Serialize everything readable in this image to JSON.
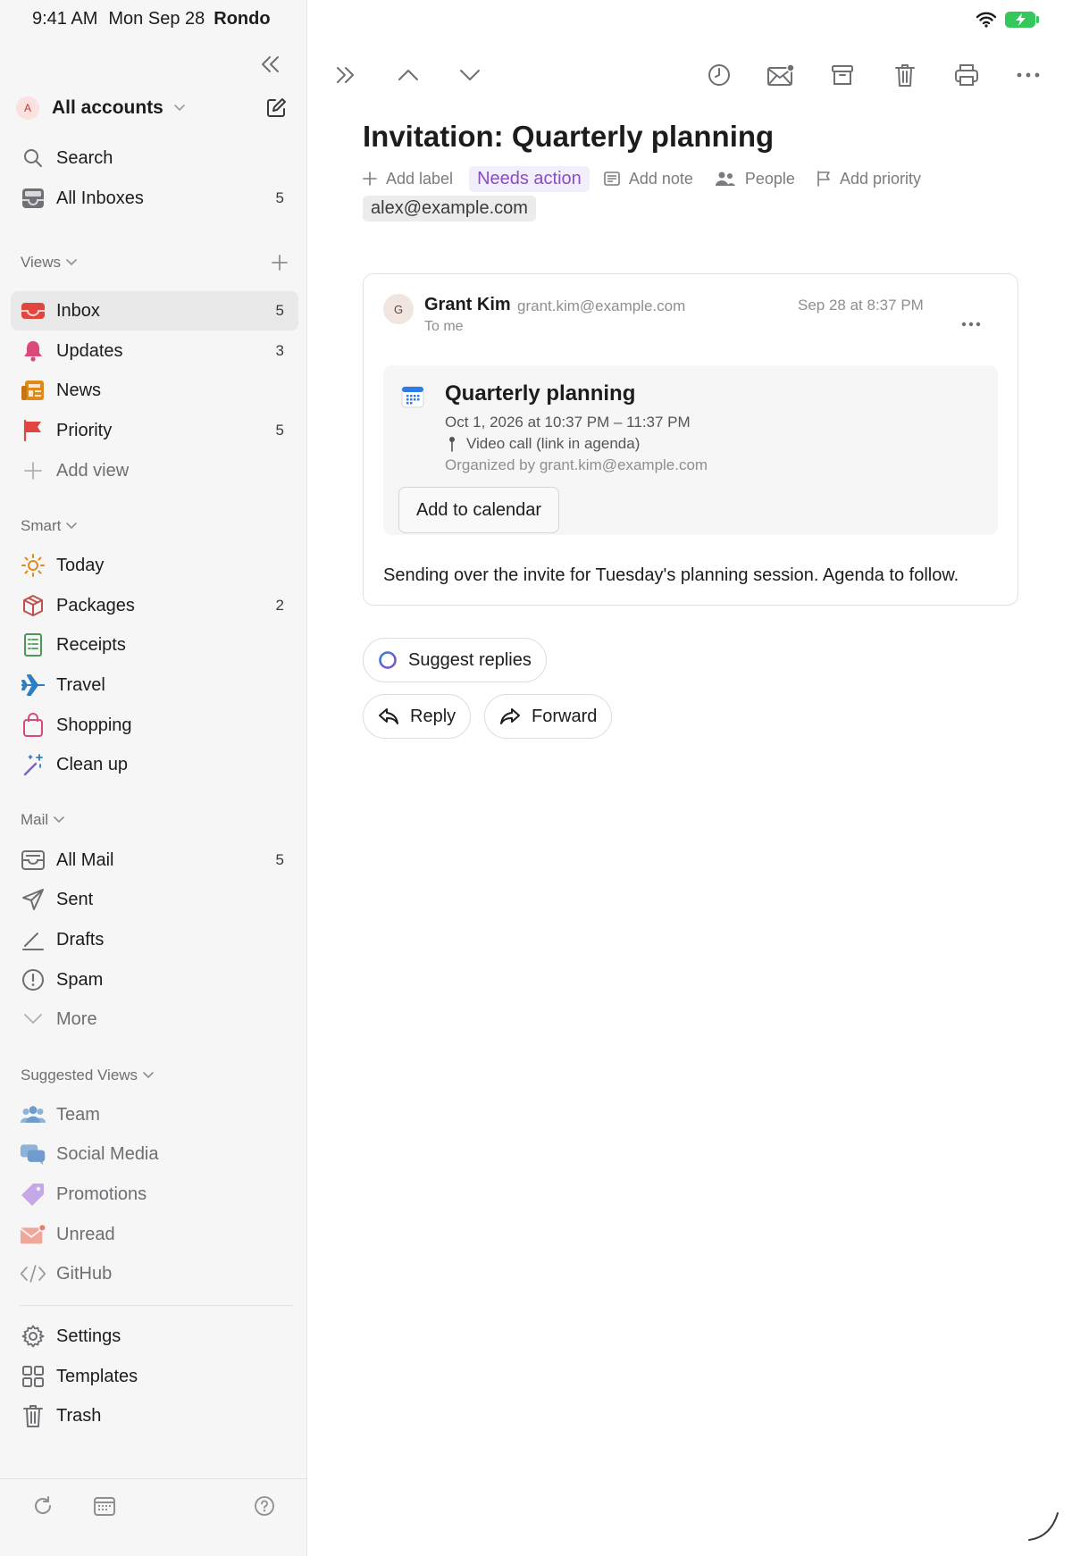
{
  "status_bar": {
    "time": "9:41 AM",
    "date": "Mon Sep 28",
    "app": "Rondo"
  },
  "account": {
    "avatar_letter": "A",
    "label": "All accounts"
  },
  "top_nav": [
    {
      "label": "Search",
      "icon": "search-icon"
    },
    {
      "label": "All Inboxes",
      "icon": "inboxes-icon",
      "count": "5"
    }
  ],
  "views": {
    "header": "Views",
    "items": [
      {
        "label": "Inbox",
        "icon": "inbox-icon",
        "count": "5",
        "active": true
      },
      {
        "label": "Updates",
        "icon": "bell-icon",
        "count": "3"
      },
      {
        "label": "News",
        "icon": "newspaper-icon",
        "count": ""
      },
      {
        "label": "Priority",
        "icon": "flag-icon",
        "count": "5"
      },
      {
        "label": "Add view",
        "icon": "plus-icon",
        "count": ""
      }
    ]
  },
  "smart": {
    "header": "Smart",
    "items": [
      {
        "label": "Today",
        "icon": "sun-icon",
        "count": ""
      },
      {
        "label": "Packages",
        "icon": "package-icon",
        "count": "2"
      },
      {
        "label": "Receipts",
        "icon": "receipt-icon",
        "count": ""
      },
      {
        "label": "Travel",
        "icon": "airplane-icon",
        "count": ""
      },
      {
        "label": "Shopping",
        "icon": "shopping-bag-icon",
        "count": ""
      },
      {
        "label": "Clean up",
        "icon": "magic-wand-icon",
        "count": ""
      }
    ]
  },
  "mail": {
    "header": "Mail",
    "items": [
      {
        "label": "All Mail",
        "icon": "tray-icon",
        "count": "5"
      },
      {
        "label": "Sent",
        "icon": "paper-plane-icon",
        "count": ""
      },
      {
        "label": "Drafts",
        "icon": "pencil-icon",
        "count": ""
      },
      {
        "label": "Spam",
        "icon": "warning-circle-icon",
        "count": ""
      },
      {
        "label": "More",
        "icon": "chevron-down-icon",
        "count": ""
      }
    ]
  },
  "suggested": {
    "header": "Suggested Views",
    "items": [
      {
        "label": "Team",
        "icon": "people-icon"
      },
      {
        "label": "Social Media",
        "icon": "chat-bubbles-icon"
      },
      {
        "label": "Promotions",
        "icon": "tag-icon"
      },
      {
        "label": "Unread",
        "icon": "unread-envelope-icon"
      },
      {
        "label": "GitHub",
        "icon": "code-icon"
      }
    ]
  },
  "bottom_nav": [
    {
      "label": "Settings",
      "icon": "gear-icon"
    },
    {
      "label": "Templates",
      "icon": "grid-icon"
    },
    {
      "label": "Trash",
      "icon": "trash-icon"
    }
  ],
  "email": {
    "subject": "Invitation: Quarterly planning",
    "meta": {
      "add_label": "Add label",
      "status_badge": "Needs action",
      "add_note": "Add note",
      "people": "People",
      "add_priority": "Add priority",
      "recipient_chip": "alex@example.com"
    },
    "message": {
      "avatar_letter": "G",
      "sender_name": "Grant Kim",
      "sender_email": "grant.kim@example.com",
      "to": "To me",
      "date": "Sep 28 at 8:37 PM",
      "invite": {
        "title": "Quarterly planning",
        "when": "Oct 1, 2026 at 10:37 PM – 11:37 PM",
        "location": "Video call (link in agenda)",
        "organizer": "Organized by grant.kim@example.com",
        "add_button": "Add to calendar"
      },
      "body": "Sending over the invite for Tuesday's planning session. Agenda to follow."
    },
    "actions": {
      "suggest_replies": "Suggest replies",
      "reply": "Reply",
      "forward": "Forward"
    }
  },
  "colors": {
    "accent_purple": "#8a4ec2",
    "inbox_red": "#e0463f",
    "updates_pink": "#d94a7a",
    "news_orange": "#e08a1e",
    "battery_green": "#34c759"
  }
}
